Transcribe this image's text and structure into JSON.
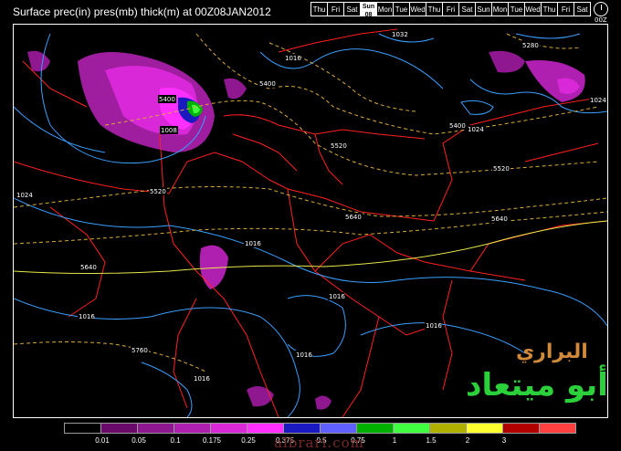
{
  "header": {
    "title": "Surface prec(in) pres(mb) thick(m) at 00Z08JAN2012",
    "days": [
      {
        "label": "Thu",
        "active": false
      },
      {
        "label": "Fri",
        "active": false
      },
      {
        "label": "Sat",
        "active": false
      },
      {
        "label": "Sun",
        "sub": "08",
        "active": true
      },
      {
        "label": "Mon",
        "active": false
      },
      {
        "label": "Tue",
        "active": false
      },
      {
        "label": "Wed",
        "active": false
      },
      {
        "label": "Thu",
        "active": false
      },
      {
        "label": "Fri",
        "active": false
      },
      {
        "label": "Sat",
        "active": false
      },
      {
        "label": "Sun",
        "active": false
      },
      {
        "label": "Mon",
        "active": false
      },
      {
        "label": "Tue",
        "active": false
      },
      {
        "label": "Wed",
        "active": false
      },
      {
        "label": "Thu",
        "active": false
      },
      {
        "label": "Fri",
        "active": false
      },
      {
        "label": "Sat",
        "active": false
      }
    ],
    "clock_label": "00Z"
  },
  "map": {
    "colors": {
      "pressure": "#3aa0ff",
      "thickness_low": "#d9a93a",
      "thickness_high": "#e8e84a",
      "borders": "#ff2020"
    },
    "contour_labels": [
      "1032",
      "1016",
      "1024",
      "5280",
      "1024",
      "5400",
      "5400",
      "5400",
      "1008",
      "5520",
      "5520",
      "5520",
      "1024",
      "5640",
      "5640",
      "5640",
      "1016",
      "1016",
      "1016",
      "1016",
      "1016",
      "5760",
      "1016"
    ]
  },
  "legend": {
    "colors": [
      "#000000",
      "#6a0a6a",
      "#8f1890",
      "#b020b0",
      "#d828d8",
      "#ff30ff",
      "#1a1ac0",
      "#6060ff",
      "#00b000",
      "#40ff40",
      "#b0b000",
      "#ffff30",
      "#b00000",
      "#ff4040"
    ],
    "labels": [
      "0.01",
      "0.05",
      "0.1",
      "0.175",
      "0.25",
      "0.375",
      "0.5",
      "0.75",
      "1",
      "1.5",
      "2",
      "3"
    ]
  },
  "watermark": {
    "line1": "البراري",
    "line2": "أبو ميتعاد",
    "site": "albrari.com"
  }
}
